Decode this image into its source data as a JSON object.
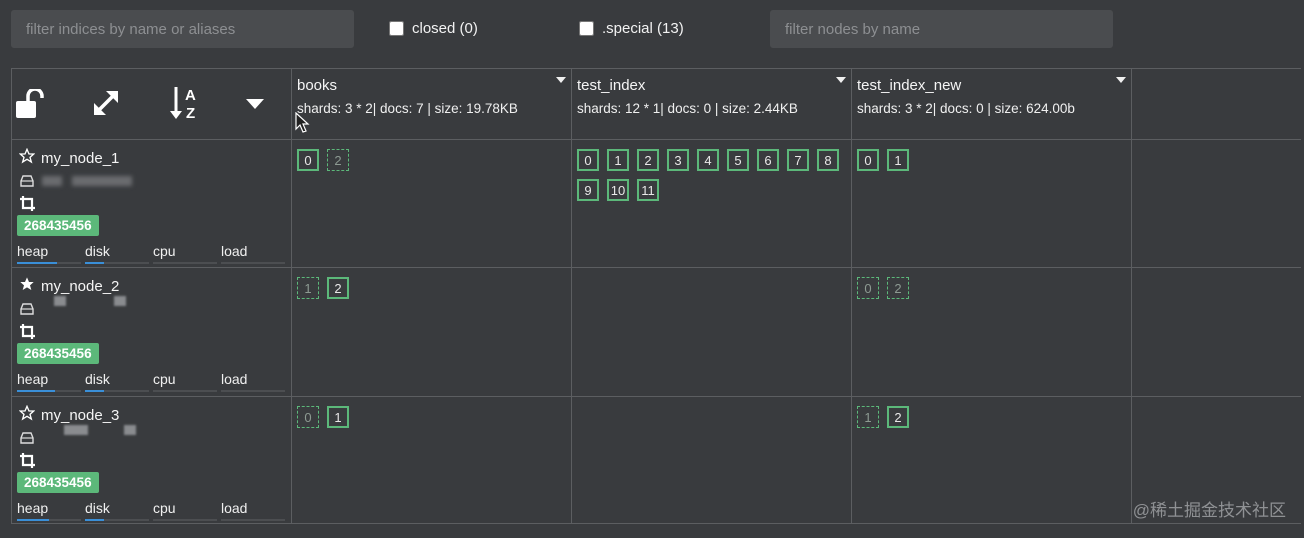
{
  "filters": {
    "indices_placeholder": "filter indices by name or aliases",
    "closed_label": "closed (0)",
    "special_label": ".special (13)",
    "nodes_placeholder": "filter nodes by name"
  },
  "toolbar": {
    "icons": [
      "unlock-icon",
      "expand-icon",
      "sort-alpha-icon",
      "caret-down-icon"
    ],
    "sort_top": "A",
    "sort_bottom": "Z"
  },
  "indices": [
    {
      "name": "books",
      "stats": "shards: 3 * 2| docs: 7 | size: 19.78KB"
    },
    {
      "name": "test_index",
      "stats": "shards: 12 * 1| docs: 0 | size: 2.44KB"
    },
    {
      "name": "test_index_new",
      "stats": "shards: 3 * 2| docs: 0 | size: 624.00b"
    }
  ],
  "nodes": [
    {
      "name": "my_node_1",
      "master": false,
      "badge": "268435456",
      "metrics": {
        "heap": 0.62,
        "disk": 0.3,
        "cpu": 0.0,
        "load": 0.0
      }
    },
    {
      "name": "my_node_2",
      "master": true,
      "badge": "268435456",
      "metrics": {
        "heap": 0.6,
        "disk": 0.3,
        "cpu": 0.0,
        "load": 0.0
      }
    },
    {
      "name": "my_node_3",
      "master": false,
      "badge": "268435456",
      "metrics": {
        "heap": 0.5,
        "disk": 0.3,
        "cpu": 0.0,
        "load": 0.0
      }
    }
  ],
  "metric_labels": {
    "heap": "heap",
    "disk": "disk",
    "cpu": "cpu",
    "load": "load"
  },
  "shards": [
    [
      [
        {
          "id": "0",
          "type": "primary"
        },
        {
          "id": "2",
          "type": "replica"
        }
      ],
      [
        {
          "id": "0",
          "type": "primary"
        },
        {
          "id": "1",
          "type": "primary"
        },
        {
          "id": "2",
          "type": "primary"
        },
        {
          "id": "3",
          "type": "primary"
        },
        {
          "id": "4",
          "type": "primary"
        },
        {
          "id": "5",
          "type": "primary"
        },
        {
          "id": "6",
          "type": "primary"
        },
        {
          "id": "7",
          "type": "primary"
        },
        {
          "id": "8",
          "type": "primary"
        },
        {
          "id": "9",
          "type": "primary"
        },
        {
          "id": "10",
          "type": "primary"
        },
        {
          "id": "11",
          "type": "primary"
        }
      ],
      [
        {
          "id": "0",
          "type": "primary"
        },
        {
          "id": "1",
          "type": "primary"
        }
      ]
    ],
    [
      [
        {
          "id": "1",
          "type": "replica"
        },
        {
          "id": "2",
          "type": "primary"
        }
      ],
      [],
      [
        {
          "id": "0",
          "type": "replica"
        },
        {
          "id": "2",
          "type": "replica"
        }
      ]
    ],
    [
      [
        {
          "id": "0",
          "type": "replica"
        },
        {
          "id": "1",
          "type": "primary"
        }
      ],
      [],
      [
        {
          "id": "1",
          "type": "replica"
        },
        {
          "id": "2",
          "type": "primary"
        }
      ]
    ]
  ],
  "watermark": "@稀土掘金技术社区",
  "colors": {
    "accent": "#5cb87a",
    "bar": "#3a8fd8",
    "background": "#393b3e"
  }
}
